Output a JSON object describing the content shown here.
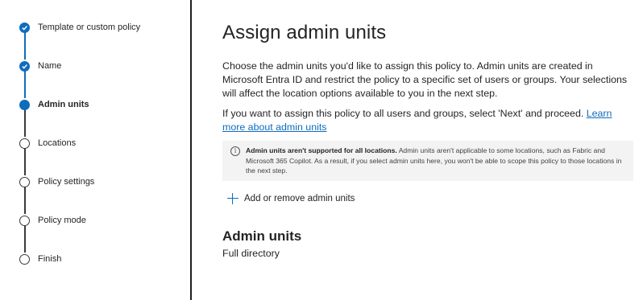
{
  "wizard": {
    "steps": [
      {
        "label": "Template or custom policy",
        "state": "completed"
      },
      {
        "label": "Name",
        "state": "completed"
      },
      {
        "label": "Admin units",
        "state": "current"
      },
      {
        "label": "Locations",
        "state": "pending"
      },
      {
        "label": "Policy settings",
        "state": "pending"
      },
      {
        "label": "Policy mode",
        "state": "pending"
      },
      {
        "label": "Finish",
        "state": "pending"
      }
    ]
  },
  "main": {
    "title": "Assign admin units",
    "description": "Choose the admin units you'd like to assign this policy to. Admin units are created in Microsoft Entra ID and restrict the policy to a specific set of users or groups. Your selections will affect the location options available to you in the next step.",
    "all_users_text": "If you want to assign this policy to all users and groups, select 'Next' and proceed. ",
    "learn_more_link": "Learn more about admin units",
    "info_banner": {
      "title": "Admin units aren't supported for all locations.",
      "body": " Admin units aren't applicable to some locations, such as Fabric and Microsoft 365 Copilot. As a result, if you select admin units here, you won't be able to scope this policy to those locations in the next step."
    },
    "add_button_label": "Add or remove admin units",
    "section_title": "Admin units",
    "section_value": "Full directory"
  },
  "colors": {
    "accent": "#0f6cbd",
    "banner_bg": "#f3f3f3",
    "text": "#242424"
  }
}
